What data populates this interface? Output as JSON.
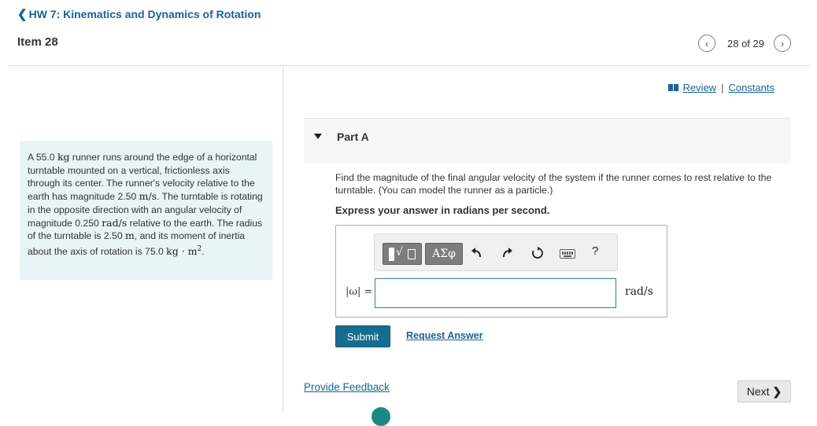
{
  "header": {
    "back_label": "HW 7: Kinematics and Dynamics of Rotation",
    "item_title": "Item 28",
    "pager_text": "28 of 29"
  },
  "resources": {
    "review": "Review",
    "separator": "|",
    "constants": "Constants"
  },
  "problem": {
    "seg1": "A 55.0 ",
    "mass_unit": "kg",
    "seg2": " runner runs around the edge of a horizontal turntable mounted on a vertical, frictionless axis through its center. The runner's velocity relative to the earth has magnitude 2.50 ",
    "speed_unit": "m/s",
    "seg3": ". The turntable is rotating in the opposite direction with an angular velocity of magnitude 0.250 ",
    "angvel_unit": "rad/s",
    "seg4": " relative to the earth. The radius of the turntable is 2.50 ",
    "radius_unit": "m",
    "seg5": ", and its moment of inertia about the axis of rotation is 75.0 ",
    "inertia_unit": "kg · m",
    "inertia_exp": "2",
    "seg6": "."
  },
  "part": {
    "title": "Part A",
    "question": "Find the magnitude of the final angular velocity of the system if the runner comes to rest relative to the turntable. (You can model the runner as a particle.)",
    "instruction": "Express your answer in radians per second."
  },
  "answer": {
    "variable_label": "|ω| =",
    "value": "",
    "unit": "rad/s",
    "toolbar": {
      "greek_label": "ΑΣφ",
      "help_label": "?"
    }
  },
  "actions": {
    "submit": "Submit",
    "request_answer": "Request Answer",
    "provide_feedback": "Provide Feedback",
    "next": "Next"
  }
}
